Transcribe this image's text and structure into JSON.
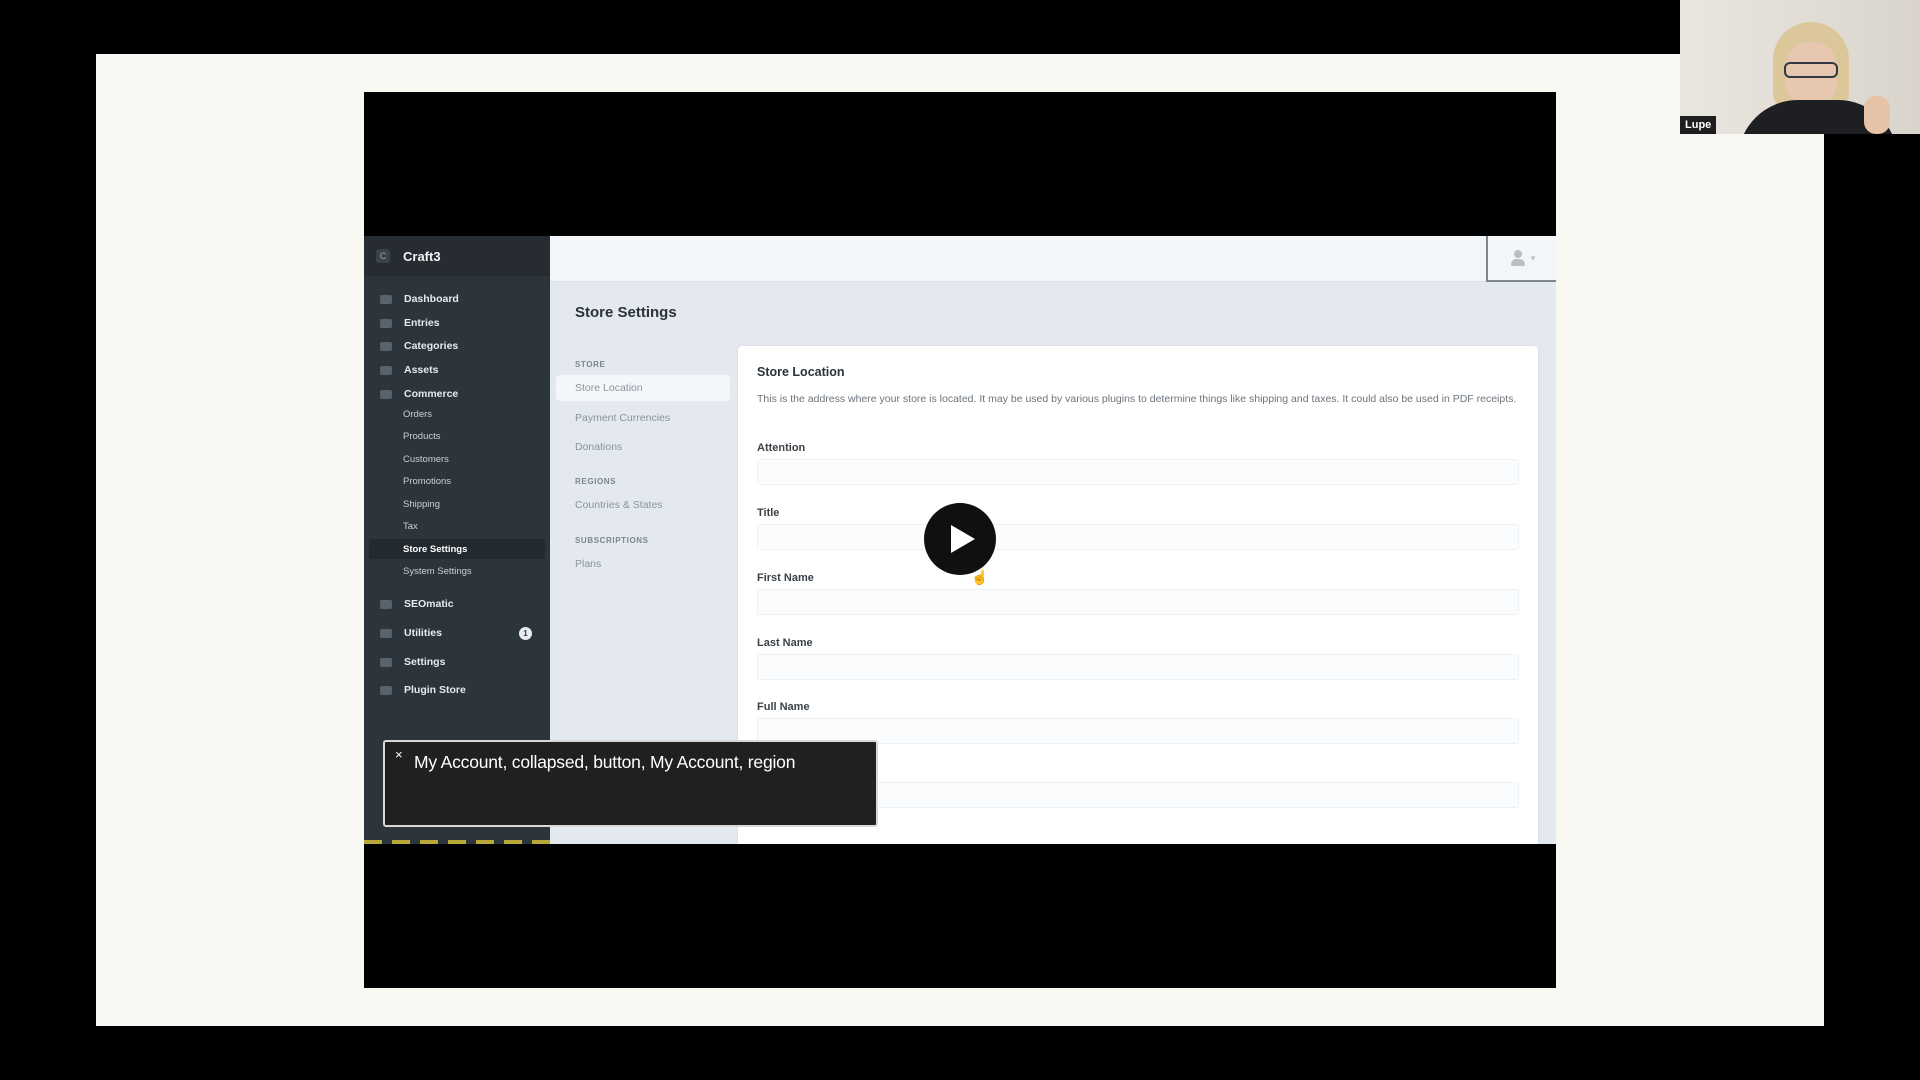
{
  "participant": {
    "name": "Lupe"
  },
  "craft": {
    "app_name": "Craft3",
    "logo_glyph": "C",
    "nav": {
      "dashboard": "Dashboard",
      "entries": "Entries",
      "categories": "Categories",
      "assets": "Assets",
      "commerce": "Commerce",
      "commerce_sub": {
        "orders": "Orders",
        "products": "Products",
        "customers": "Customers",
        "promotions": "Promotions",
        "shipping": "Shipping",
        "tax": "Tax",
        "store_settings": "Store Settings",
        "system_settings": "System Settings"
      },
      "seomatic": "SEOmatic",
      "utilities": "Utilities",
      "utilities_badge": "1",
      "settings": "Settings",
      "plugin_store": "Plugin Store"
    },
    "page_title": "Store Settings",
    "subnav": {
      "store_heading": "STORE",
      "store_location": "Store Location",
      "payment_currencies": "Payment Currencies",
      "donations": "Donations",
      "regions_heading": "REGIONS",
      "countries_states": "Countries & States",
      "subscriptions_heading": "SUBSCRIPTIONS",
      "plans": "Plans"
    },
    "panel": {
      "heading": "Store Location",
      "description": "This is the address where your store is located. It may be used by various plugins to determine things like shipping and taxes. It could also be used in PDF receipts.",
      "fields": {
        "attention": "Attention",
        "title": "Title",
        "first_name": "First Name",
        "last_name": "Last Name",
        "full_name": "Full Name"
      }
    }
  },
  "caption": {
    "close_glyph": "×",
    "text": "My Account, collapsed, button, My Account, region"
  }
}
